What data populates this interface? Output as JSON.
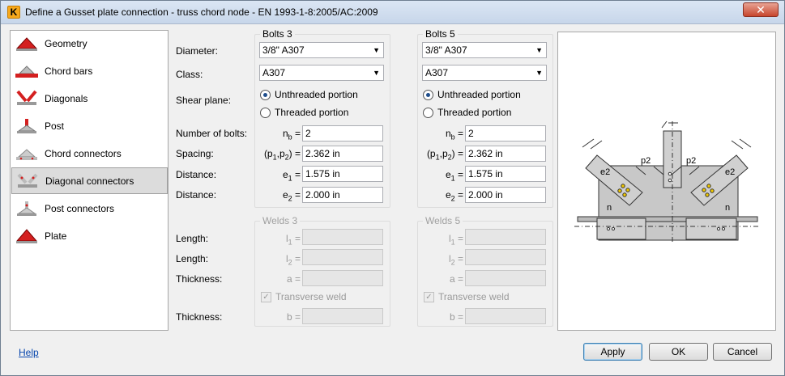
{
  "window": {
    "title": "Define a Gusset plate connection - truss chord node - EN 1993-1-8:2005/AC:2009",
    "close_label": "✕"
  },
  "sidebar": {
    "items": [
      {
        "label": "Geometry",
        "icon": "geometry-icon"
      },
      {
        "label": "Chord bars",
        "icon": "chord-bars-icon"
      },
      {
        "label": "Diagonals",
        "icon": "diagonals-icon"
      },
      {
        "label": "Post",
        "icon": "post-icon"
      },
      {
        "label": "Chord connectors",
        "icon": "chord-connectors-icon"
      },
      {
        "label": "Diagonal connectors",
        "icon": "diagonal-connectors-icon",
        "selected": true
      },
      {
        "label": "Post connectors",
        "icon": "post-connectors-icon"
      },
      {
        "label": "Plate",
        "icon": "plate-icon"
      }
    ]
  },
  "labels": {
    "diameter": "Diameter:",
    "class": "Class:",
    "shear_plane": "Shear plane:",
    "num_bolts": "Number of bolts:",
    "spacing": "Spacing:",
    "distance1": "Distance:",
    "distance2": "Distance:",
    "length1": "Length:",
    "length2": "Length:",
    "thickness1": "Thickness:",
    "thickness2": "Thickness:"
  },
  "bolts3": {
    "title": "Bolts 3",
    "diameter": "3/8\" A307",
    "class": "A307",
    "shear_unthreaded": "Unthreaded portion",
    "shear_threaded": "Threaded portion",
    "nb_sym": "n",
    "nb_sub": "b",
    "nb": "2",
    "p_sym": "(p",
    "p_sub1": "1",
    "p_mid": ",p",
    "p_sub2": "2",
    "p_end": ")",
    "spacing": "2.362 in",
    "e1_sym": "e",
    "e1_sub": "1",
    "e1": "1.575 in",
    "e2_sym": "e",
    "e2_sub": "2",
    "e2": "2.000 in"
  },
  "bolts5": {
    "title": "Bolts 5",
    "diameter": "3/8\" A307",
    "class": "A307",
    "shear_unthreaded": "Unthreaded portion",
    "shear_threaded": "Threaded portion",
    "nb_sym": "n",
    "nb_sub": "b",
    "nb": "2",
    "p_sym": "(p",
    "p_sub1": "1",
    "p_mid": ",p",
    "p_sub2": "2",
    "p_end": ")",
    "spacing": "2.362 in",
    "e1_sym": "e",
    "e1_sub": "1",
    "e1": "1.575 in",
    "e2_sym": "e",
    "e2_sub": "2",
    "e2": "2.000 in"
  },
  "welds3": {
    "title": "Welds 3",
    "l1_sym": "l",
    "l1_sub": "1",
    "l2_sym": "l",
    "l2_sub": "2",
    "a_sym": "a",
    "b_sym": "b",
    "transverse": "Transverse weld"
  },
  "welds5": {
    "title": "Welds 5",
    "l1_sym": "l",
    "l1_sub": "1",
    "l2_sym": "l",
    "l2_sub": "2",
    "a_sym": "a",
    "b_sym": "b",
    "transverse": "Transverse weld"
  },
  "eq": " =",
  "preview": {
    "p2_left": "p2",
    "p2_right": "p2",
    "e2_left": "e2",
    "e2_right": "e2",
    "n_left": "n",
    "n_right": "n"
  },
  "footer": {
    "help": "Help",
    "apply": "Apply",
    "ok": "OK",
    "cancel": "Cancel"
  },
  "colors": {
    "accent_red": "#d42020",
    "selection": "#dcdcdc",
    "link": "#0645ad"
  }
}
